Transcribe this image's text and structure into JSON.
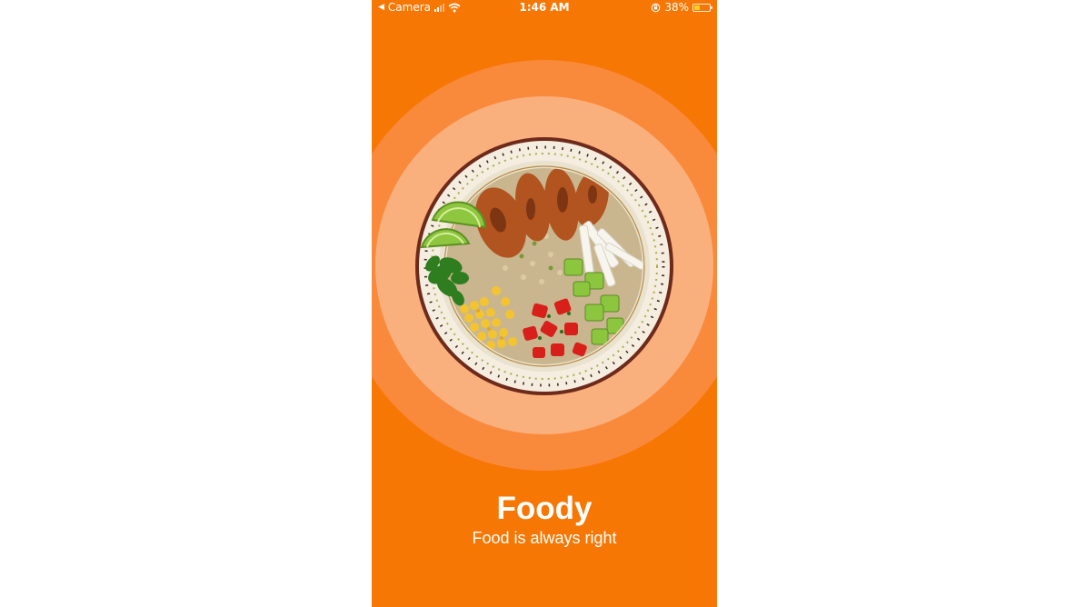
{
  "status_bar": {
    "back_app": "Camera",
    "time": "1:46 AM",
    "battery_percent": "38%",
    "battery_level": 0.38
  },
  "colors": {
    "accent": "#f77705",
    "ring_outer": "#f98a3c",
    "ring_inner": "#fab07c"
  },
  "hero": {
    "image_icon": "food-bowl-image"
  },
  "splash": {
    "title": "Foody",
    "subtitle": "Food is always right"
  }
}
